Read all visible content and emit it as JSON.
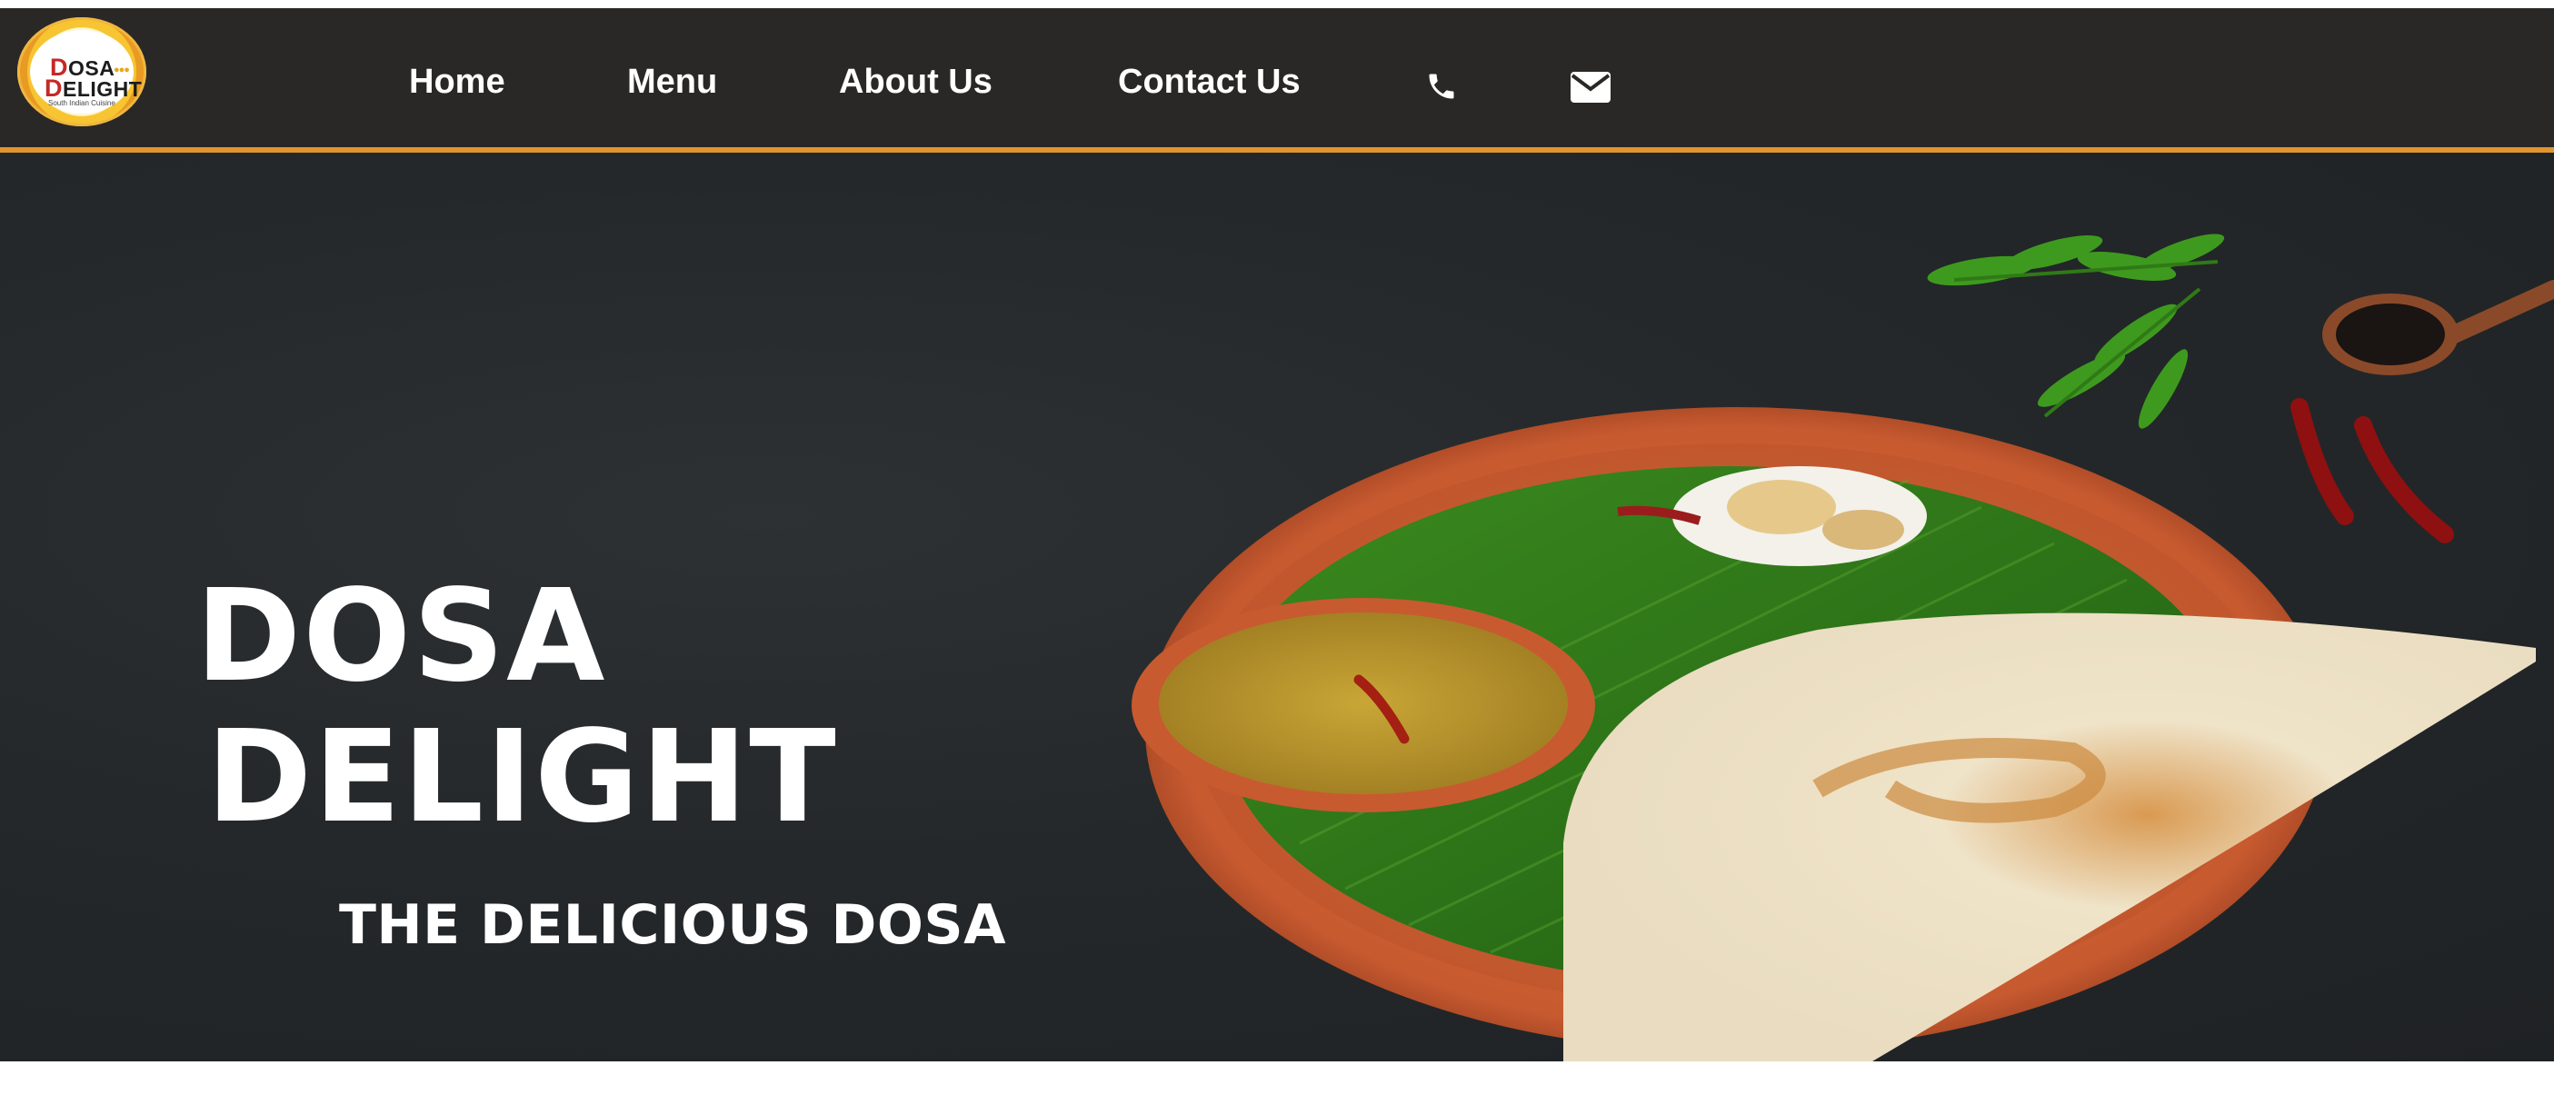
{
  "brand": {
    "logo_line1": "DOSA",
    "logo_line2": "DELIGHT",
    "logo_tagline": "South Indian Cuisine"
  },
  "nav": {
    "items": [
      {
        "label": "Home"
      },
      {
        "label": "Menu"
      },
      {
        "label": "About Us"
      },
      {
        "label": "Contact Us"
      }
    ],
    "icons": [
      "phone-icon",
      "mail-icon"
    ]
  },
  "hero": {
    "title_line1": "DOSA",
    "title_line2": "DELIGHT",
    "subtitle": "THE DELICIOUS DOSA"
  },
  "colors": {
    "navbar_bg": "#2a2826",
    "accent": "#e0952e",
    "hero_bg": "#24282a",
    "text": "#ffffff"
  }
}
